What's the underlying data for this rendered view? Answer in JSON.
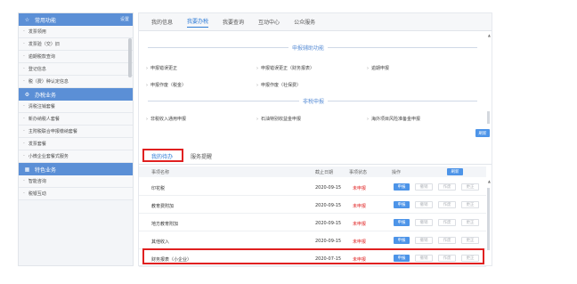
{
  "sidebar": {
    "sections": [
      {
        "title": "常用功能",
        "action": "设置",
        "items": [
          "发票领用",
          "发票验（交）旧",
          "逾期税款查询",
          "登记信息",
          "税（费）种认定信息"
        ]
      },
      {
        "title": "办税业务",
        "action": "",
        "items": [
          "清税注销套餐",
          "新办纳税人套餐",
          "主附税联合申报缴纳套餐",
          "发票套餐",
          "小微企业套餐式服务"
        ]
      },
      {
        "title": "特色业务",
        "action": "",
        "items": [
          "智能咨询",
          "税银互动"
        ]
      }
    ]
  },
  "main": {
    "tabs": [
      {
        "label": "我的信息",
        "active": false
      },
      {
        "label": "我要办税",
        "active": true
      },
      {
        "label": "我要查询",
        "active": false
      },
      {
        "label": "互动中心",
        "active": false
      },
      {
        "label": "公众服务",
        "active": false
      }
    ],
    "section1_title": "申报辅助功能",
    "section1_links": [
      "申报错误更正",
      "申报错误更正（财务报表）",
      "逾期申报",
      "申报作废（税金）",
      "申报作废（社保费）"
    ],
    "section2_title": "非税申报",
    "section2_links": [
      "非税收入通用申报",
      "石油特别收益金申报",
      "海外项目风险准备金申报"
    ],
    "refresh_button": "刷新"
  },
  "lower": {
    "tabs": [
      {
        "label": "我的待办",
        "active": true
      },
      {
        "label": "服务提醒",
        "active": false
      }
    ],
    "columns": [
      "事项名称",
      "截止日期",
      "事项状态",
      "操作"
    ],
    "refresh_button": "刷新",
    "op_labels": [
      "申报",
      "撤销",
      "作废",
      "更正"
    ],
    "rows": [
      {
        "name": "印花税",
        "date": "2020-09-15",
        "status": "未申报"
      },
      {
        "name": "教育费附加",
        "date": "2020-09-15",
        "status": "未申报"
      },
      {
        "name": "地方教育附加",
        "date": "2020-09-15",
        "status": "未申报"
      },
      {
        "name": "其他收入",
        "date": "2020-09-15",
        "status": "未申报"
      },
      {
        "name": "财务报表（小企业）",
        "date": "2020-07-15",
        "status": "未申报"
      }
    ]
  },
  "colors": {
    "accent": "#4d94e8",
    "sidebar_header": "#5b8fd6",
    "highlight": "#e02020",
    "status_pending": "#e02020"
  }
}
